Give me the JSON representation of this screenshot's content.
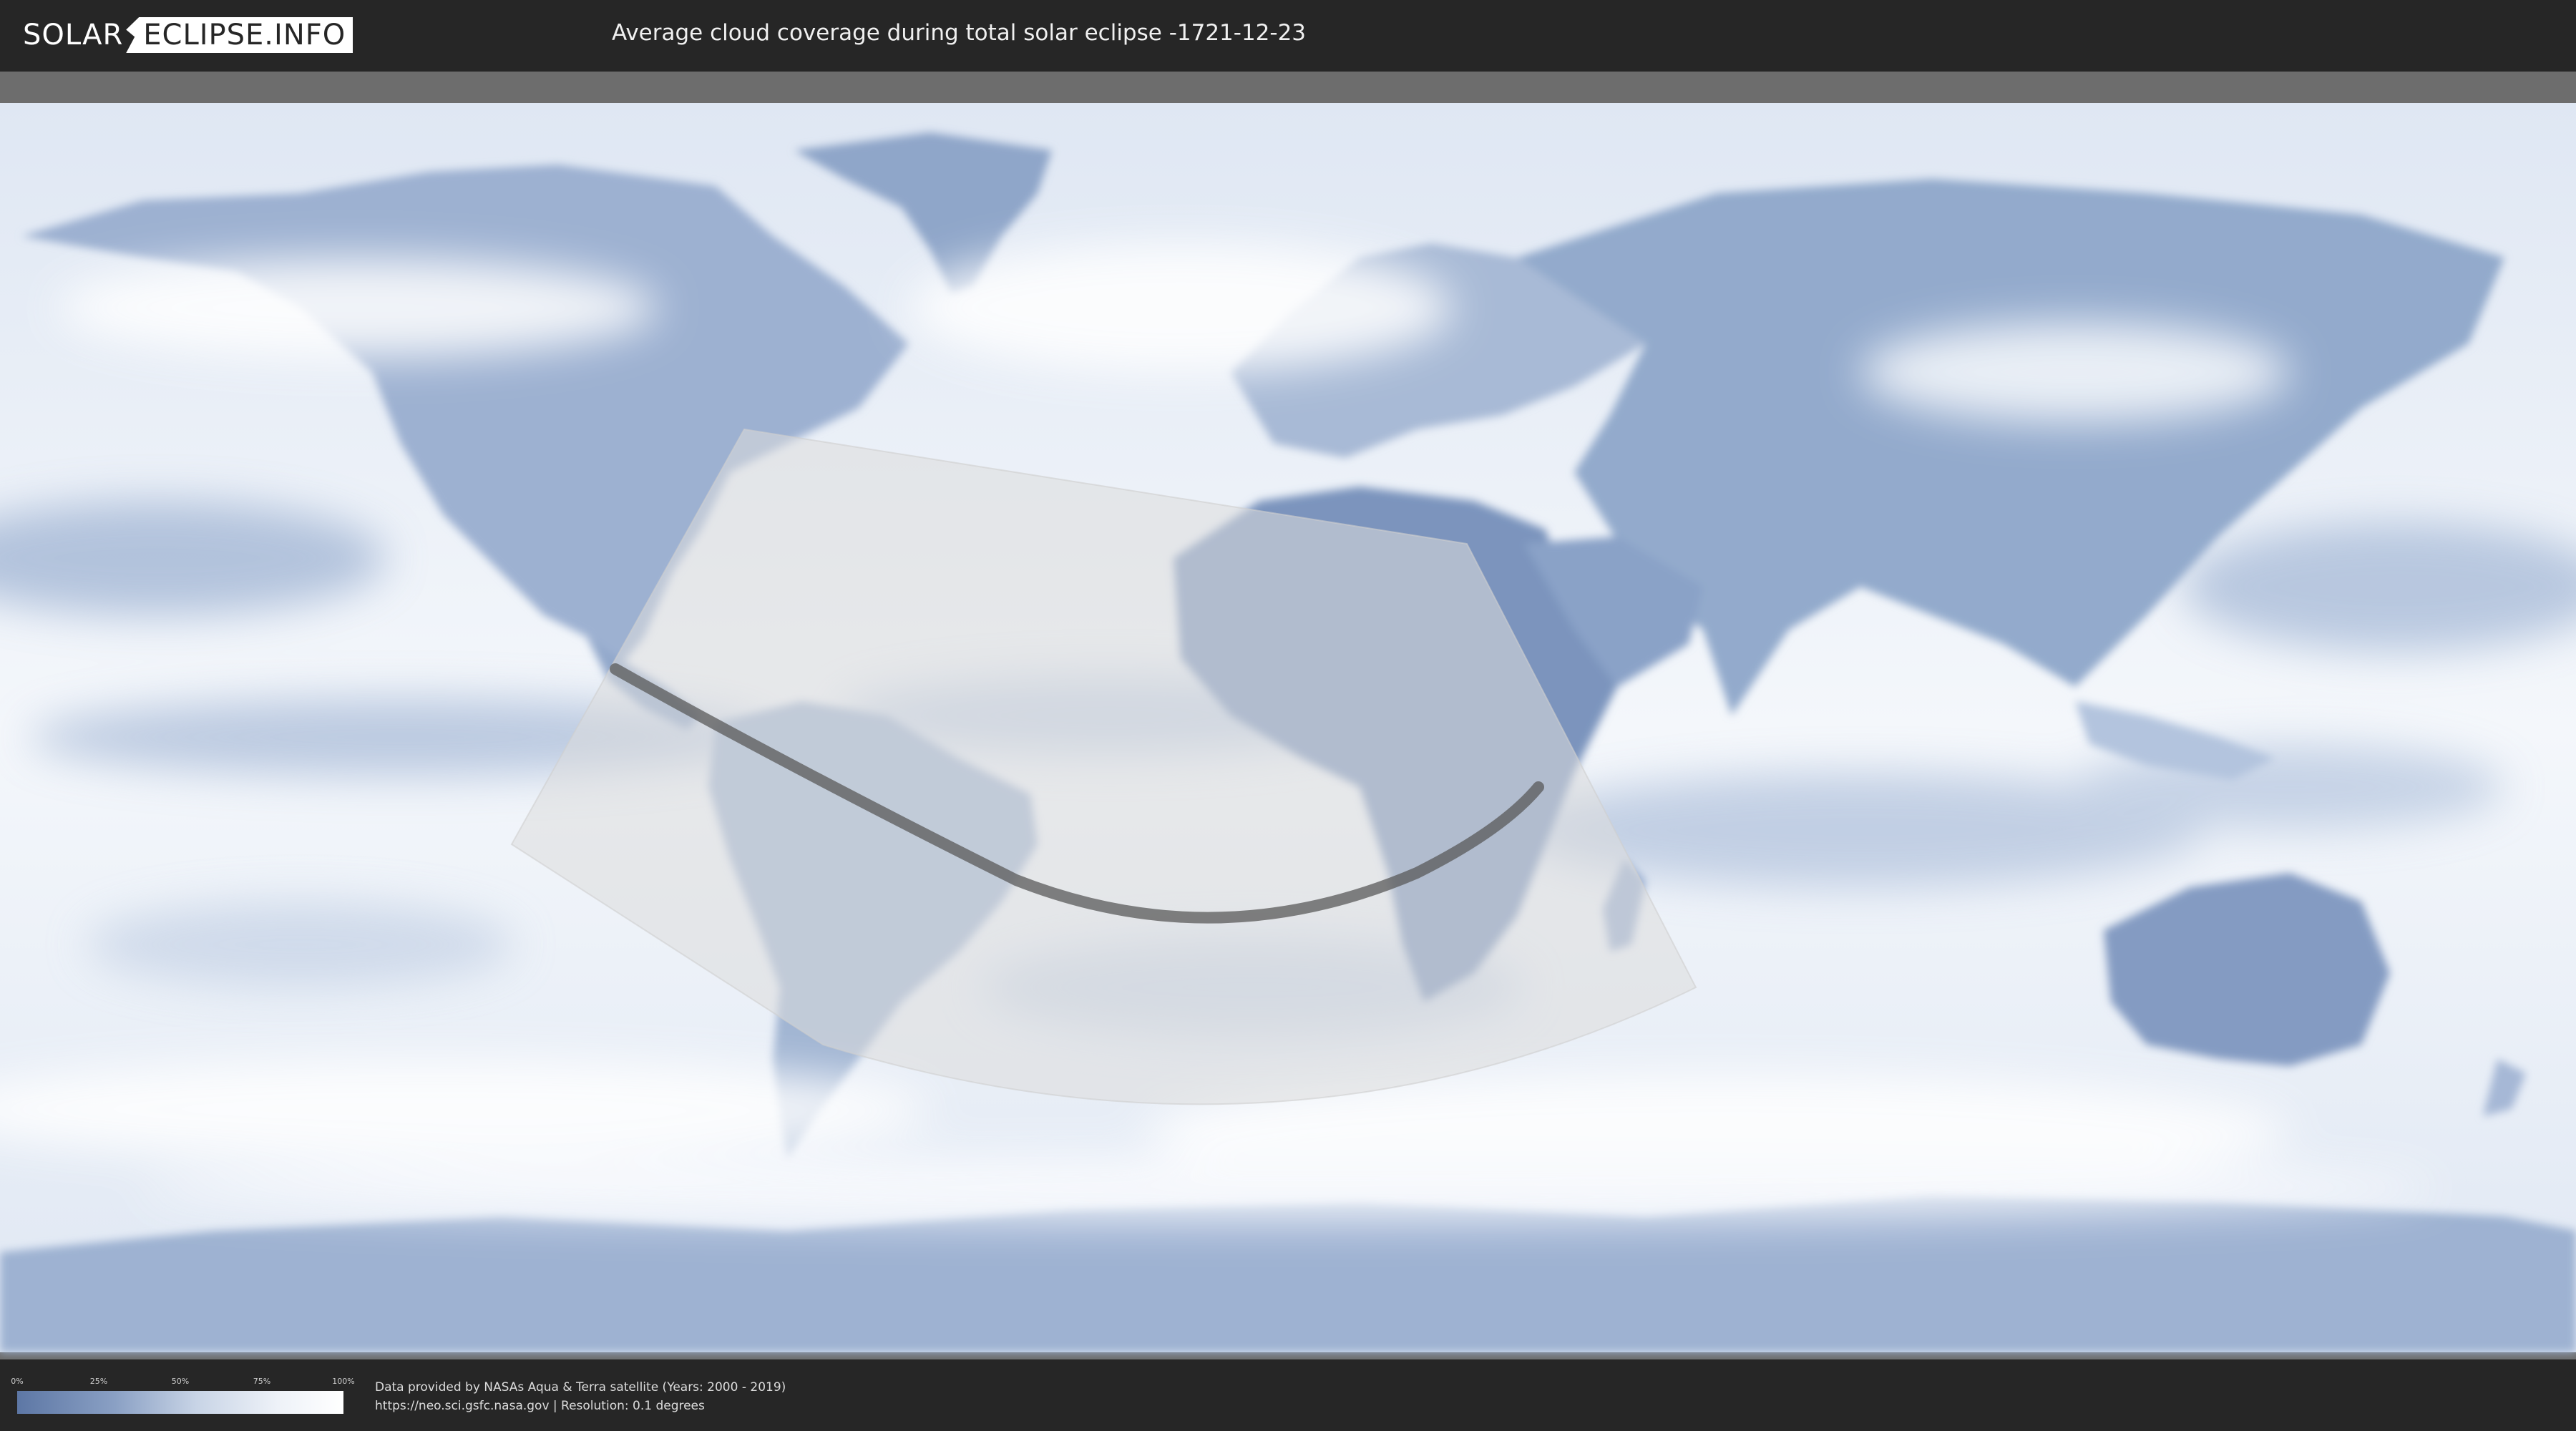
{
  "header": {
    "logo_left": "SOLAR",
    "logo_right": "ECLIPSE.INFO",
    "title": "Average cloud coverage during total solar eclipse -1721-12-23"
  },
  "legend": {
    "ticks": [
      "0%",
      "25%",
      "50%",
      "75%",
      "100%"
    ],
    "colors": [
      "#5d77a5",
      "#8aa0c4",
      "#c8d4e6",
      "#eef2f8",
      "#ffffff"
    ]
  },
  "credits": {
    "line1": "Data provided by NASAs Aqua & Terra satellite (Years: 2000 - 2019)",
    "line2": "https://neo.sci.gsfc.nasa.gov | Resolution: 0.1 degrees"
  },
  "map": {
    "ocean_color": "#eef3fa",
    "cloud_low_color": "#7f98c0",
    "eclipse_zone_color": "#d9d9d9",
    "eclipse_path_color": "#555555"
  }
}
